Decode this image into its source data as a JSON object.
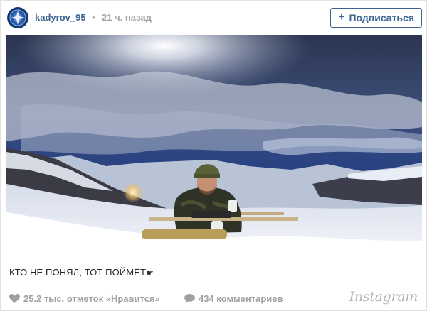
{
  "post": {
    "username": "kadyrov_95",
    "separator": "•",
    "time_ago": "21 ч. назад",
    "follow_label": "Подписаться",
    "caption": "КТО НЕ ПОНЯЛ, ТОТ ПОЙМЁТ",
    "caption_emoji": "☛",
    "likes_text": "25.2 тыс. отметок «Нравится»",
    "comments_text": "434 комментариев",
    "brand": "Instagram"
  },
  "icons": {
    "avatar": "avatar-emblem-icon",
    "follow": "plus-icon",
    "like": "heart-icon",
    "comment": "speech-bubble-icon",
    "caption_emoji": "pointing-hand-icon"
  },
  "colors": {
    "link_blue": "#3d6591",
    "meta_gray": "#a5a5a5",
    "footer_gray": "#a0a0a0",
    "logo_gray": "#b5b5b5"
  }
}
